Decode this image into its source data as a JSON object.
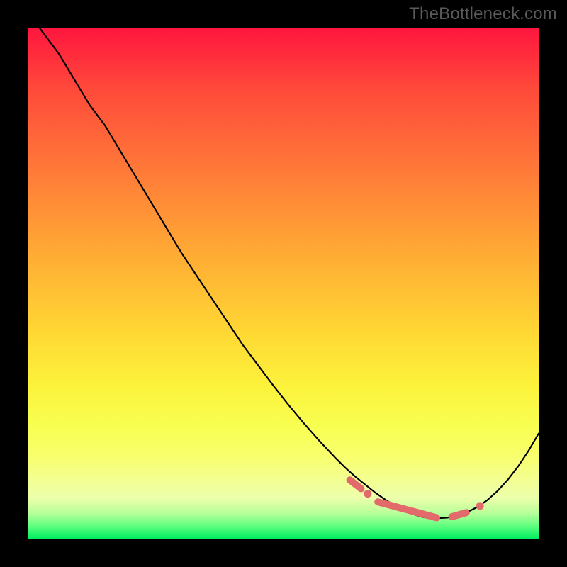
{
  "watermark": "TheBottleneck.com",
  "colors": {
    "background": "#000000",
    "curve": "#000000",
    "marker": "#e26a6a",
    "gradient_top": "#ff163e",
    "gradient_bottom": "#00ee61"
  },
  "chart_data": {
    "type": "line",
    "title": "",
    "xlabel": "",
    "ylabel": "",
    "xlim": [
      0,
      100
    ],
    "ylim": [
      0,
      100
    ],
    "series": [
      {
        "name": "bottleneck-curve",
        "x": [
          0,
          3,
          6,
          9,
          12,
          15,
          18,
          21,
          24,
          27,
          30,
          33,
          36,
          39,
          42,
          45,
          48,
          51,
          54,
          57,
          60,
          62,
          64,
          66,
          68,
          70,
          72,
          74,
          75,
          76,
          77,
          78,
          79,
          80,
          82,
          84,
          86,
          88,
          90,
          92,
          94,
          96,
          98,
          100
        ],
        "y": [
          103,
          99,
          95,
          90,
          85,
          81,
          76,
          71,
          66,
          61,
          56,
          51.5,
          47,
          42.5,
          38,
          34,
          30,
          26.2,
          22.6,
          19.2,
          16,
          14,
          12.2,
          10.6,
          9.0,
          7.6,
          6.4,
          5.4,
          5.0,
          4.6,
          4.3,
          4.1,
          4.0,
          4.0,
          4.1,
          4.5,
          5.2,
          6.2,
          7.6,
          9.4,
          11.6,
          14.2,
          17.2,
          20.6
        ]
      }
    ],
    "markers": {
      "name": "highlight-region",
      "color": "#e26a6a",
      "segments": [
        {
          "x1": 63.0,
          "y1": 11.5,
          "x2": 65.2,
          "y2": 9.8
        },
        {
          "x1": 68.5,
          "y1": 7.2,
          "x2": 80.0,
          "y2": 4.1
        },
        {
          "x1": 83.0,
          "y1": 4.3,
          "x2": 85.8,
          "y2": 5.1
        }
      ],
      "dots": [
        {
          "x": 66.5,
          "y": 8.8
        },
        {
          "x": 88.5,
          "y": 6.4
        }
      ]
    }
  }
}
